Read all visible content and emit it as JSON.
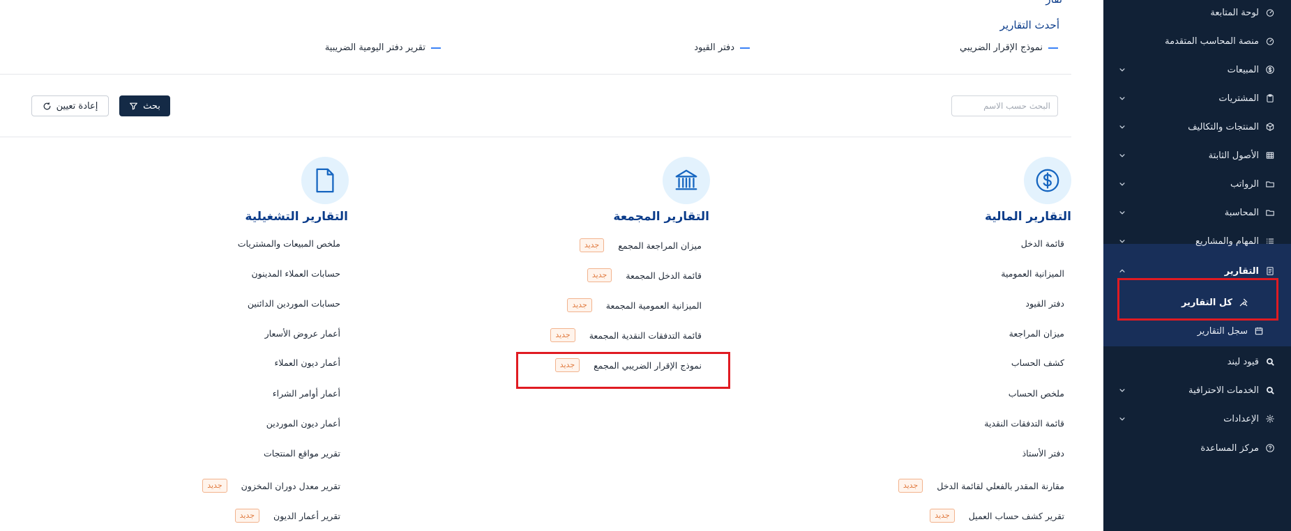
{
  "sidebar": {
    "items": [
      {
        "label": "لوحة المتابعة",
        "icon": "gauge-icon",
        "chevron": false
      },
      {
        "label": "منصة المحاسب المتقدمة",
        "icon": "gauge-icon",
        "chevron": false
      },
      {
        "label": "المبيعات",
        "icon": "dollar-circle-icon",
        "chevron": true
      },
      {
        "label": "المشتريات",
        "icon": "clipboard-icon",
        "chevron": true
      },
      {
        "label": "المنتجات والتكاليف",
        "icon": "cube-icon",
        "chevron": true
      },
      {
        "label": "الأصول الثابتة",
        "icon": "grid-icon",
        "chevron": true
      },
      {
        "label": "الرواتب",
        "icon": "folder-icon",
        "chevron": true
      },
      {
        "label": "المحاسبة",
        "icon": "folder-icon",
        "chevron": true
      },
      {
        "label": "المهام والمشاريع",
        "icon": "list-icon",
        "chevron": true
      },
      {
        "label": "التقارير",
        "icon": "report-icon",
        "chevron": true
      },
      {
        "label": "قيود ليند",
        "icon": "search-icon",
        "chevron": false
      },
      {
        "label": "الخدمات الاحترافية",
        "icon": "search-icon",
        "chevron": true
      },
      {
        "label": "الإعدادات",
        "icon": "gear-icon",
        "chevron": true
      },
      {
        "label": "مركز المساعدة",
        "icon": "help-icon",
        "chevron": false
      }
    ],
    "reports_sub": {
      "all_reports": "كل التقارير",
      "reports_log": "سجل التقارير"
    }
  },
  "main": {
    "top_partial": "تقار",
    "latest_title": "أحدث التقارير",
    "latest_links": [
      "نموذج الإقرار الضريبي",
      "دفتر القيود",
      "تقرير دفتر اليومية الضريبية"
    ],
    "search": {
      "placeholder": "البحث حسب الاسم",
      "button_label": "بحث",
      "reset_label": "إعادة تعيين"
    },
    "new_badge": "جديد",
    "categories": [
      {
        "title": "التقارير المالية",
        "icon": "dollar-circle-icon",
        "reports": [
          {
            "label": "قائمة الدخل",
            "new": false
          },
          {
            "label": "الميزانية العمومية",
            "new": false
          },
          {
            "label": "دفتر القيود",
            "new": false
          },
          {
            "label": "ميزان المراجعة",
            "new": false
          },
          {
            "label": "كشف الحساب",
            "new": false
          },
          {
            "label": "ملخص الحساب",
            "new": false
          },
          {
            "label": "قائمة التدفقات النقدية",
            "new": false
          },
          {
            "label": "دفتر الأستاذ",
            "new": false
          },
          {
            "label": "مقارنة المقدر بالفعلي لقائمة الدخل",
            "new": true
          },
          {
            "label": "تقرير كشف حساب العميل",
            "new": true
          }
        ]
      },
      {
        "title": "التقارير المجمعة",
        "icon": "bank-icon",
        "reports": [
          {
            "label": "ميزان المراجعة المجمع",
            "new": true
          },
          {
            "label": "قائمة الدخل المجمعة",
            "new": true
          },
          {
            "label": "الميزانية العمومية المجمعة",
            "new": true
          },
          {
            "label": "قائمة التدفقات النقدية المجمعة",
            "new": true
          },
          {
            "label": "نموذج الإقرار الضريبي المجمع",
            "new": true
          }
        ]
      },
      {
        "title": "التقارير التشغيلية",
        "icon": "document-icon",
        "reports": [
          {
            "label": "ملخص المبيعات والمشتريات",
            "new": false
          },
          {
            "label": "حسابات العملاء المدينون",
            "new": false
          },
          {
            "label": "حسابات الموردين الدائنين",
            "new": false
          },
          {
            "label": "أعمار عروض الأسعار",
            "new": false
          },
          {
            "label": "أعمار ديون العملاء",
            "new": false
          },
          {
            "label": "أعمار أوامر الشراء",
            "new": false
          },
          {
            "label": "أعمار ديون الموردين",
            "new": false
          },
          {
            "label": "تقرير مواقع المنتجات",
            "new": false
          },
          {
            "label": "تقرير معدل دوران المخزون",
            "new": true
          },
          {
            "label": "تقرير أعمار الديون",
            "new": true
          }
        ]
      }
    ]
  },
  "colors": {
    "sidebar_bg": "#112136",
    "sidebar_active_bg": "#182f59",
    "heading_blue": "#0b3c8a",
    "accent_blue": "#3b82f6",
    "badge_orange": "#e07a3f",
    "highlight_red": "#e01b22",
    "icon_circle_bg": "#e3f2fd"
  }
}
